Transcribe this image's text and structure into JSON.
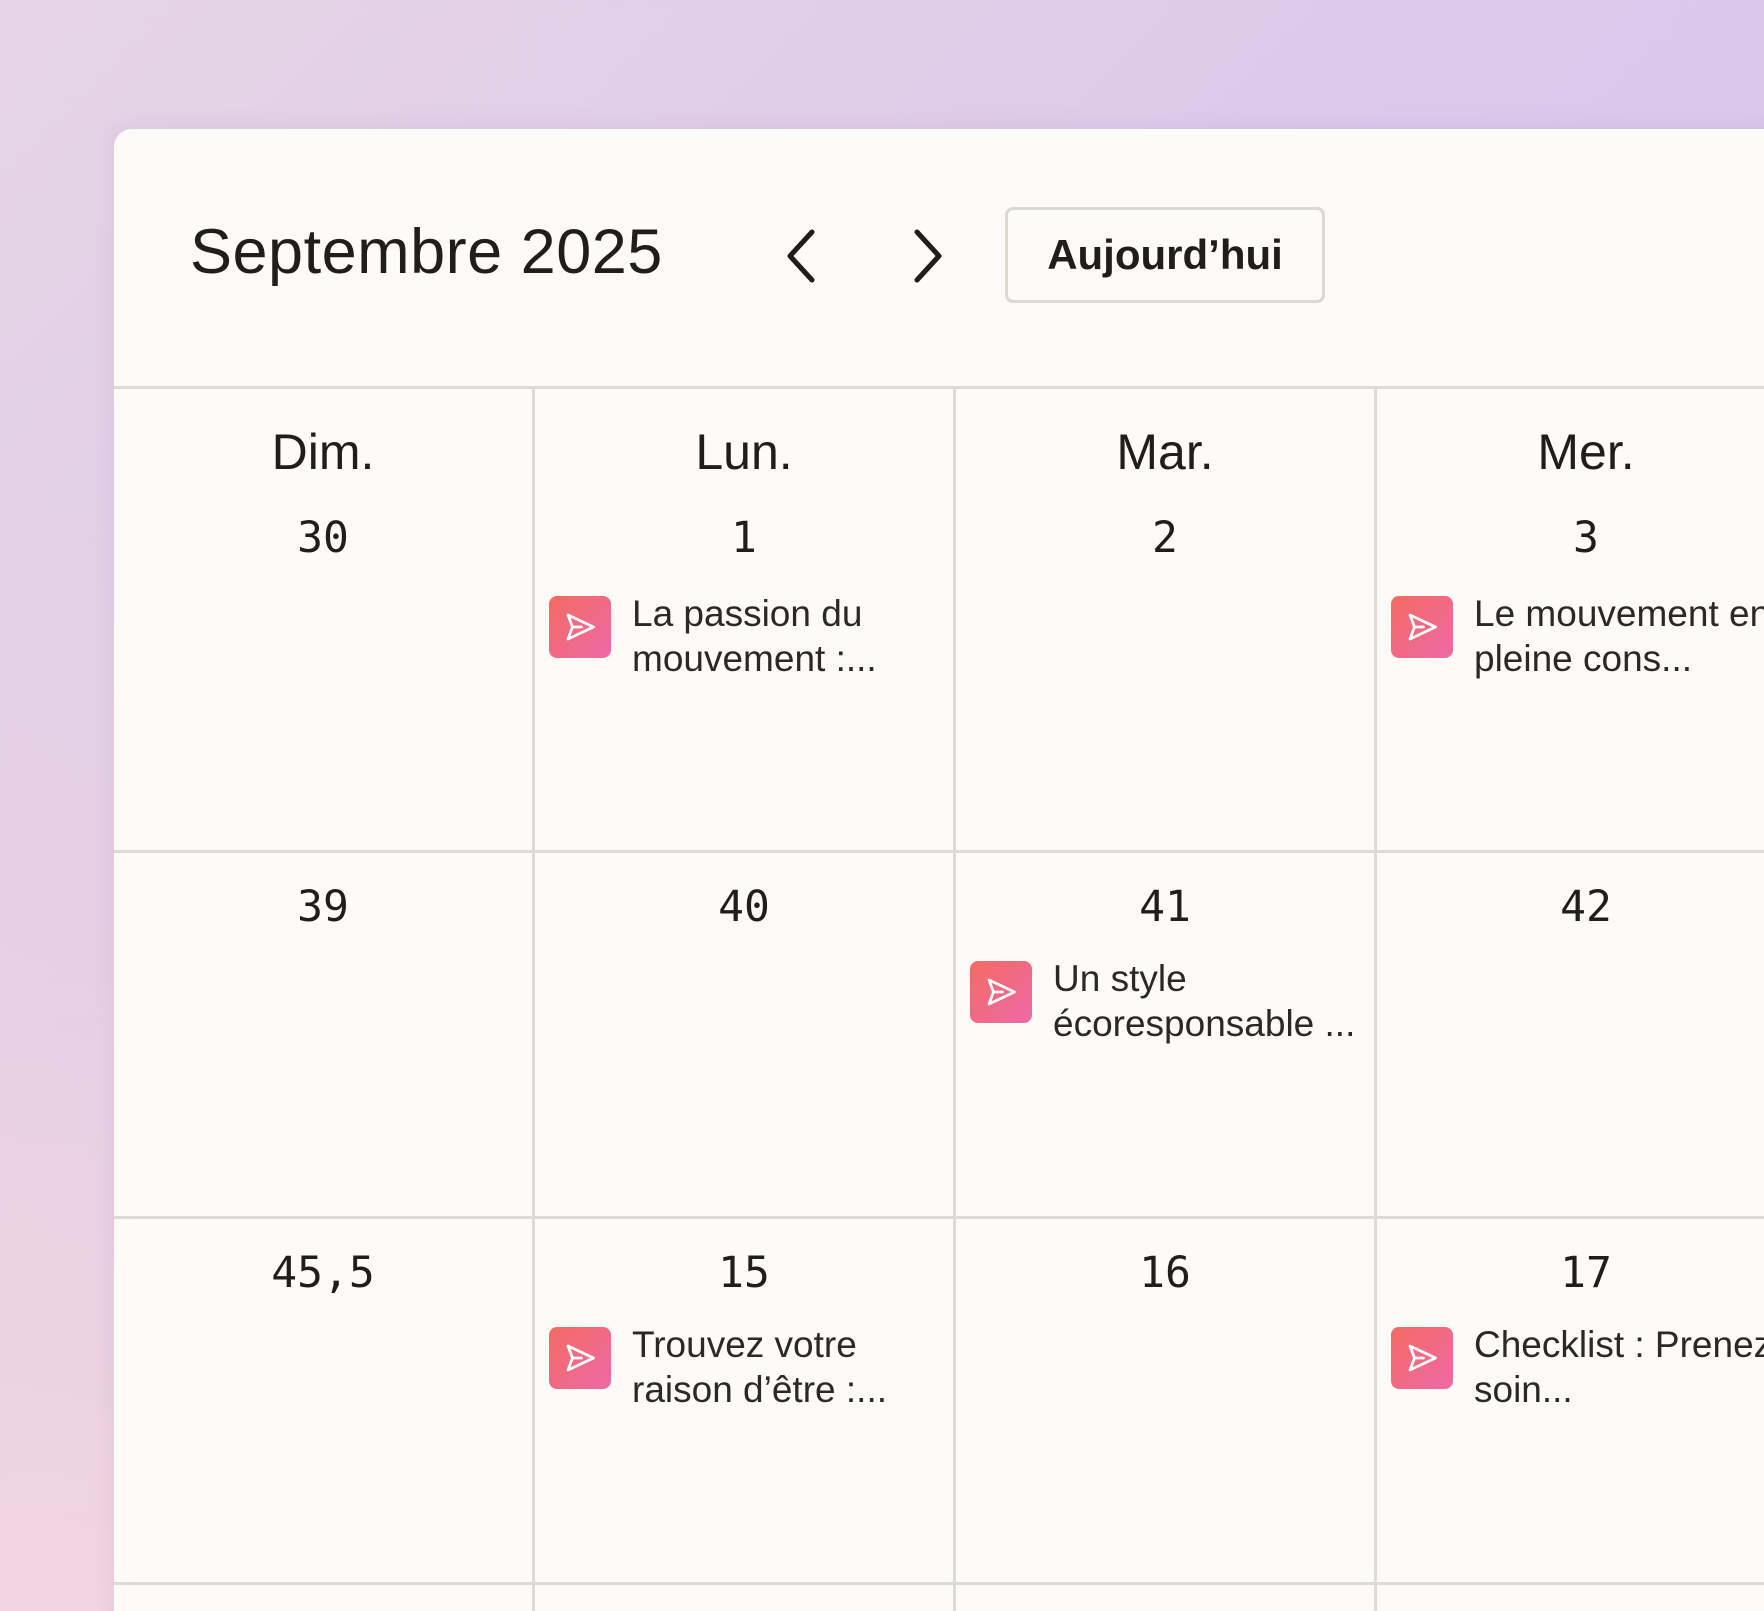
{
  "calendar": {
    "month_title": "Septembre 2025",
    "today_label": "Aujourd’hui",
    "day_names": [
      "Dim.",
      "Lun.",
      "Mar.",
      "Mer."
    ],
    "weeks": [
      [
        {
          "num": "30",
          "event": null
        },
        {
          "num": "1",
          "event": "La passion du mouvement :..."
        },
        {
          "num": "2",
          "event": null
        },
        {
          "num": "3",
          "event": "Le mouvement en pleine cons..."
        }
      ],
      [
        {
          "num": "39",
          "event": null
        },
        {
          "num": "40",
          "event": null
        },
        {
          "num": "41",
          "event": "Un style écoresponsable ..."
        },
        {
          "num": "42",
          "event": null
        }
      ],
      [
        {
          "num": "45,5",
          "event": null
        },
        {
          "num": "15",
          "event": "Trouvez votre raison d’être :..."
        },
        {
          "num": "16",
          "event": null
        },
        {
          "num": "17",
          "event": "Checklist : Prenez soin..."
        }
      ]
    ]
  },
  "icons": {
    "prev": "chevron-left-icon",
    "next": "chevron-right-icon",
    "event": "send-icon"
  },
  "colors": {
    "event_icon_gradient": [
      "#f36b62",
      "#ee6aa7"
    ],
    "panel_background": "#fdfbf8",
    "grid_line": "#dedbd6"
  }
}
